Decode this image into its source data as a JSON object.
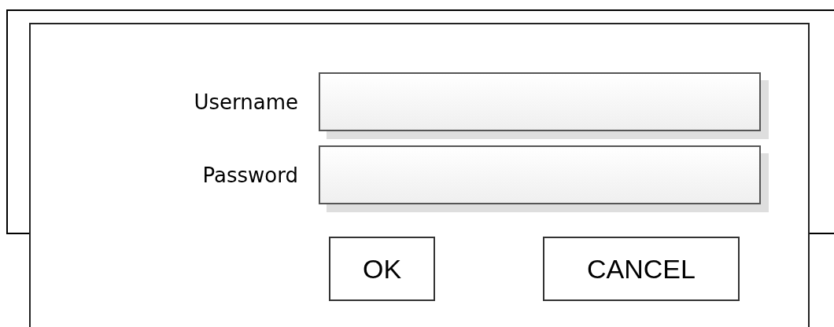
{
  "dialog": {
    "fields": [
      {
        "label": "Username"
      },
      {
        "label": "Password"
      }
    ],
    "buttons": [
      {
        "label": "OK"
      },
      {
        "label": "CANCEL"
      }
    ]
  }
}
